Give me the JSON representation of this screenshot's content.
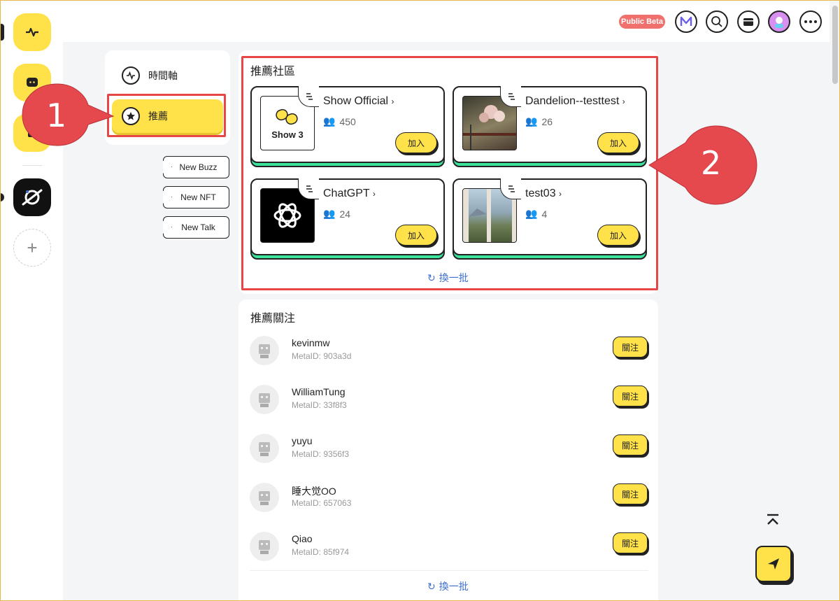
{
  "topbar": {
    "beta_label": "Public Beta",
    "icons": [
      "metaid-logo-icon",
      "search-icon",
      "wallet-icon",
      "user-avatar-icon",
      "more-icon"
    ]
  },
  "rail": {
    "items": [
      "activity-icon",
      "chat-icon",
      "community-icon",
      "orbit-app-icon"
    ],
    "add_label": "+"
  },
  "subnav": {
    "items": [
      {
        "label": "時間軸",
        "icon": "timeline-icon"
      },
      {
        "label": "推薦",
        "icon": "star-icon"
      }
    ],
    "tags": [
      "New Buzz",
      "New NFT",
      "New Talk"
    ]
  },
  "communities": {
    "title": "推薦社區",
    "items": [
      {
        "name": "Show Official",
        "members": "450",
        "thumb_text": "Show 3",
        "join": "加入"
      },
      {
        "name": "Dandelion--testtest",
        "members": "26",
        "join": "加入"
      },
      {
        "name": "ChatGPT",
        "members": "24",
        "join": "加入"
      },
      {
        "name": "test03",
        "members": "4",
        "join": "加入"
      }
    ],
    "refresh_label": "換一批"
  },
  "follows": {
    "title": "推薦關注",
    "items": [
      {
        "name": "kevinmw",
        "meta": "MetaID: 903a3d",
        "action": "關注"
      },
      {
        "name": "WilliamTung",
        "meta": "MetaID: 33f8f3",
        "action": "關注"
      },
      {
        "name": "yuyu",
        "meta": "MetaID: 9356f3",
        "action": "關注"
      },
      {
        "name": "睡大觉OO",
        "meta": "MetaID: 657063",
        "action": "關注"
      },
      {
        "name": "Qiao",
        "meta": "MetaID: 85f974",
        "action": "關注"
      }
    ],
    "refresh_label": "換一批"
  },
  "callouts": [
    "1",
    "2"
  ],
  "colors": {
    "accent": "#ffe14a",
    "card_shadow": "#3be39b",
    "highlight": "#e64646",
    "beta": "#f0706e",
    "link": "#3d6fd0"
  }
}
